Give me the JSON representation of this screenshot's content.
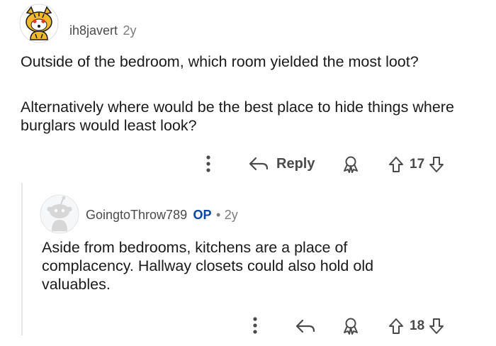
{
  "comment1": {
    "username": "ih8javert",
    "age": "2y",
    "avatar_icon": "tiger-snoo-avatar-icon",
    "paragraphs": [
      "Outside of the bedroom, which room yielded the most loot?",
      "Alternatively where would be the best place to hide things where burglars would least look?"
    ],
    "actions": {
      "more_icon": "more-vertical-icon",
      "reply_icon": "reply-arrow-icon",
      "reply_label": "Reply",
      "award_icon": "award-icon",
      "upvote_icon": "upvote-arrow-icon",
      "score": "17",
      "downvote_icon": "downvote-arrow-icon"
    }
  },
  "comment2": {
    "username": "GoingtoThrow789",
    "op_badge": "OP",
    "separator": "•",
    "age": "2y",
    "avatar_icon": "default-snoo-avatar-icon",
    "text": "Aside from bedrooms, kitchens are a place of complacency. Hallway closets could also hold old valuables.",
    "actions": {
      "more_icon": "more-vertical-icon",
      "reply_icon": "reply-arrow-icon",
      "award_icon": "award-icon",
      "upvote_icon": "upvote-arrow-icon",
      "score": "18",
      "downvote_icon": "downvote-arrow-icon"
    }
  },
  "colors": {
    "text": "#1a1a1b",
    "meta": "#7c7c7c",
    "op": "#0a44a6",
    "thread_line": "#e5e5e5"
  }
}
